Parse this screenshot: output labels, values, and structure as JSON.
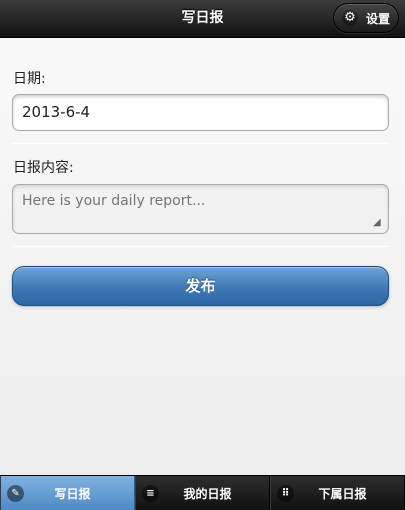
{
  "header": {
    "title": "写日报",
    "settings_label": "设置",
    "settings_icon": "gear-icon"
  },
  "form": {
    "date_label": "日期:",
    "date_value": "2013-6-4",
    "report_label": "日报内容:",
    "report_placeholder": "Here is your daily report...",
    "publish_label": "发布"
  },
  "tabs": [
    {
      "label": "写日报",
      "icon": "pencil-icon",
      "active": true
    },
    {
      "label": "我的日报",
      "icon": "list-icon",
      "active": false
    },
    {
      "label": "下属日报",
      "icon": "grid-icon",
      "active": false
    }
  ],
  "colors": {
    "accent": "#4a86c2",
    "header": "#1a1a1a",
    "tab_active": "#6aa4d8"
  }
}
